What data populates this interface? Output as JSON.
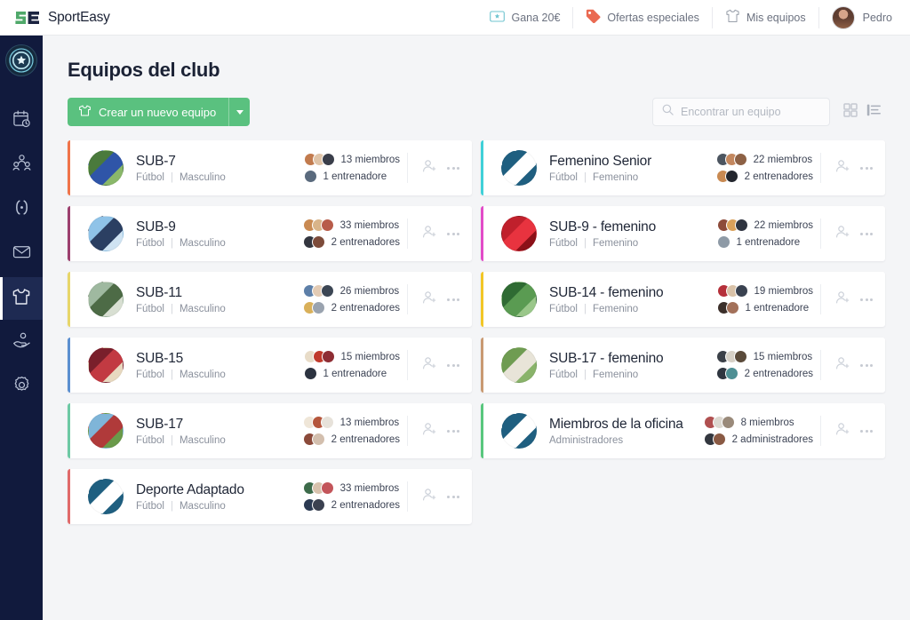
{
  "brand": {
    "logo_s": "S",
    "logo_e": "E",
    "name_part1": "Sport",
    "name_part2": "Easy"
  },
  "topnav": {
    "items": [
      {
        "label": "Gana 20€",
        "icon": "ticket-star-icon"
      },
      {
        "label": "Ofertas especiales",
        "icon": "price-tag-icon"
      },
      {
        "label": "Mis equipos",
        "icon": "tshirt-icon"
      },
      {
        "label": "Pedro",
        "icon": "user-avatar"
      }
    ]
  },
  "sidebar": {
    "club_badge": "club-logo",
    "items": [
      {
        "name": "calendar-clock-icon",
        "active": false
      },
      {
        "name": "people-group-icon",
        "active": false
      },
      {
        "name": "brackets-icon",
        "active": false
      },
      {
        "name": "envelope-icon",
        "active": false
      },
      {
        "name": "tshirt-icon",
        "active": true
      },
      {
        "name": "hand-person-icon",
        "active": false
      },
      {
        "name": "gear-icon",
        "active": false
      }
    ]
  },
  "page": {
    "title": "Equipos del club",
    "create_button": "Crear un nuevo equipo",
    "create_button_icon": "tshirt-icon",
    "create_button_caret": "chevron-down-icon",
    "accent_green": "#5ac17f"
  },
  "search": {
    "placeholder": "Encontrar un equipo",
    "value": "",
    "icon": "search-icon"
  },
  "view_toggle": {
    "grid_icon": "grid-view-icon",
    "list_icon": "list-view-icon",
    "selected": "list"
  },
  "teams": {
    "left": [
      {
        "name": "SUB-7",
        "sport": "Fútbol",
        "category": "Masculino",
        "stripe": "#f0744a",
        "avatar_colors": [
          "#4a7a3c",
          "#2f55a8",
          "#8ab86a"
        ],
        "members_count": "13 miembros",
        "coaches_count": "1 entrenadore",
        "member_avatars": [
          "#c27b4e",
          "#e0c4a8",
          "#3a3e4a"
        ],
        "coach_avatars": [
          "#5a6a7d"
        ]
      },
      {
        "name": "SUB-9",
        "sport": "Fútbol",
        "category": "Masculino",
        "stripe": "#9c3f6e",
        "avatar_colors": [
          "#8fc3e8",
          "#2b3f62",
          "#cfe3f2"
        ],
        "members_count": "33 miembros",
        "coaches_count": "2 entrenadores",
        "member_avatars": [
          "#c98a52",
          "#d9b489",
          "#b85c4a"
        ],
        "coach_avatars": [
          "#33363f",
          "#7d4b3a"
        ]
      },
      {
        "name": "SUB-11",
        "sport": "Fútbol",
        "category": "Masculino",
        "stripe": "#e7d66a",
        "avatar_colors": [
          "#9fb9a0",
          "#4d6b46",
          "#d8dfd2"
        ],
        "members_count": "26 miembros",
        "coaches_count": "2 entrenadores",
        "member_avatars": [
          "#5d7fa8",
          "#e3cbb4",
          "#3c4654"
        ],
        "coach_avatars": [
          "#d9b05a",
          "#9aa3af"
        ]
      },
      {
        "name": "SUB-15",
        "sport": "Fútbol",
        "category": "Masculino",
        "stripe": "#5b8fd0",
        "avatar_colors": [
          "#7a1f2b",
          "#c23a42",
          "#e8d9c0"
        ],
        "members_count": "15 miembros",
        "coaches_count": "1 entrenadore",
        "member_avatars": [
          "#e8dcc8",
          "#c0392b",
          "#8e2d34"
        ],
        "coach_avatars": [
          "#2c3340"
        ]
      },
      {
        "name": "SUB-17",
        "sport": "Fútbol",
        "category": "Masculino",
        "stripe": "#6dc9a4",
        "avatar_colors": [
          "#7fb5d8",
          "#b03a3a",
          "#6a9a4a"
        ],
        "members_count": "13 miembros",
        "coaches_count": "2 entrenadores",
        "member_avatars": [
          "#efe6d8",
          "#b5563c",
          "#e7e2da"
        ],
        "coach_avatars": [
          "#8b4a3a",
          "#d3bfae"
        ]
      },
      {
        "name": "Deporte Adaptado",
        "sport": "Fútbol",
        "category": "Masculino",
        "stripe": "#e06a6a",
        "avatar_colors": [
          "#1f5f80",
          "#ffffff",
          "#1f5f80"
        ],
        "members_count": "33 miembros",
        "coaches_count": "2 entrenadores",
        "member_avatars": [
          "#3d6b4a",
          "#d8c2ad",
          "#c3555a"
        ],
        "coach_avatars": [
          "#2b3a52",
          "#3b4150"
        ]
      }
    ],
    "right": [
      {
        "name": "Femenino Senior",
        "sport": "Fútbol",
        "category": "Femenino",
        "stripe": "#3fd0d8",
        "avatar_colors": [
          "#1f5f80",
          "#ffffff",
          "#1f5f80"
        ],
        "members_count": "22 miembros",
        "coaches_count": "2 entrenadores",
        "member_avatars": [
          "#4c5560",
          "#c3875e",
          "#8d6145"
        ],
        "coach_avatars": [
          "#c98a52",
          "#23262e"
        ]
      },
      {
        "name": "SUB-9 - femenino",
        "sport": "Fútbol",
        "category": "Femenino",
        "stripe": "#e24bc8",
        "avatar_colors": [
          "#c0202c",
          "#e8333f",
          "#8c1018"
        ],
        "members_count": "22 miembros",
        "coaches_count": "1 entrenadore",
        "member_avatars": [
          "#8d4b3a",
          "#d9a05a",
          "#2f3440"
        ],
        "coach_avatars": [
          "#8e9aa6"
        ]
      },
      {
        "name": "SUB-14 - femenino",
        "sport": "Fútbol",
        "category": "Femenino",
        "stripe": "#f2c626",
        "avatar_colors": [
          "#2f6b33",
          "#5a9b52",
          "#9ac78a"
        ],
        "members_count": "19 miembros",
        "coaches_count": "1 entrenadore",
        "member_avatars": [
          "#b5303a",
          "#d9c2a8",
          "#3a4250"
        ],
        "coach_avatars": [
          "#3b2f2a",
          "#a3715a"
        ]
      },
      {
        "name": "SUB-17 - femenino",
        "sport": "Fútbol",
        "category": "Femenino",
        "stripe": "#c99a72",
        "avatar_colors": [
          "#6f9c52",
          "#e8e4d8",
          "#89b36a"
        ],
        "members_count": "15 miembros",
        "coaches_count": "2 entrenadores",
        "member_avatars": [
          "#3b4048",
          "#d6d0c6",
          "#5a4a3a"
        ],
        "coach_avatars": [
          "#2f3640",
          "#4e8f94"
        ]
      },
      {
        "name": "Miembros de la oficina",
        "sport": "Administradores",
        "category": "",
        "stripe": "#58c77d",
        "avatar_colors": [
          "#1f5f80",
          "#ffffff",
          "#1f5f80"
        ],
        "members_count": "8 miembros",
        "coaches_count": "2 administradores",
        "member_avatars": [
          "#b05050",
          "#dcd8d0",
          "#9a8a7a"
        ],
        "coach_avatars": [
          "#33373f",
          "#8a5a44"
        ]
      }
    ]
  },
  "card_actions": {
    "add_person_icon": "add-person-icon",
    "more_icon": "more-dots-icon"
  }
}
